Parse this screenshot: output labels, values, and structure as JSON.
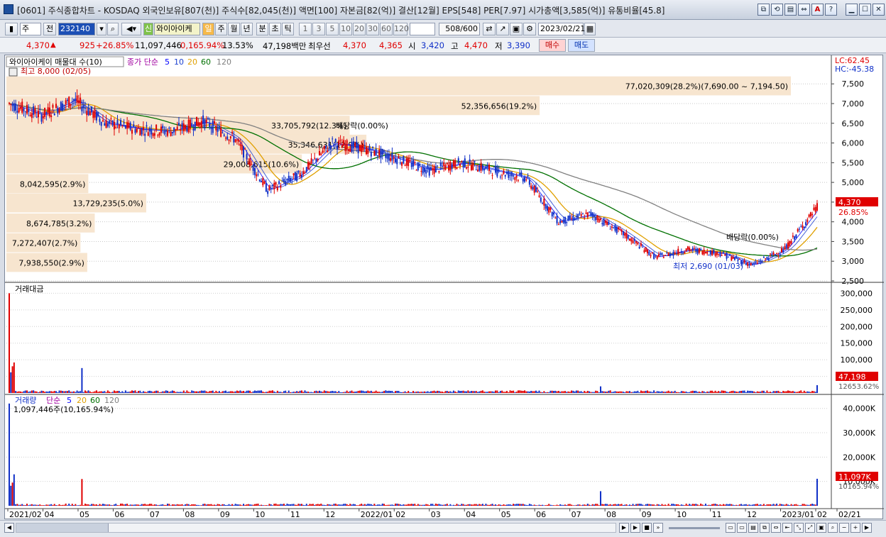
{
  "window": {
    "title": "[0601] 주식종합차트 - KOSDAQ 외국인보유[807(천)] 주식수[82,045(천)] 액면[100] 자본금[82(억)] 결산[12월] EPS[548] PER[7.97] 시가총액[3,585(억)] 유통비율[45.8]",
    "buttons": [
      "⧉",
      "⟲",
      "▤",
      "⇔",
      "A",
      "?",
      "▁",
      "☐",
      "✕"
    ]
  },
  "toolbar": {
    "type_label": "주",
    "prev_label": "전",
    "code": "232140",
    "stock_name": "와이아이케",
    "period_day": "일",
    "period_week": "주",
    "period_month": "월",
    "period_year": "년",
    "period_minute": "분",
    "period_second": "초",
    "period_tick": "틱",
    "intervals": [
      "1",
      "3",
      "5",
      "10",
      "20",
      "30",
      "60",
      "120"
    ],
    "count": "508",
    "count_max": "/600",
    "date": "2023/02/21"
  },
  "quote": {
    "price": "4,370",
    "change": "925",
    "change_pct": "+26.85%",
    "volume": "11,097,446",
    "volume_ratio": "0,165.94%",
    "turnover_pct": "13.53%",
    "amount": "47,198백만",
    "best_label": "최우선",
    "ask": "4,370",
    "bid": "4,365",
    "open_label": "시",
    "open": "3,420",
    "high_label": "고",
    "high": "4,470",
    "low_label": "저",
    "low": "3,390",
    "buy_label": "매수",
    "sell_label": "매도"
  },
  "price_panel": {
    "legend_name": "와이아이케이 매물대 수(10)",
    "legend_ma": "종가 단순",
    "ma_periods": [
      "5",
      "10",
      "20",
      "60",
      "120"
    ],
    "ma_colors": [
      "#0000ff",
      "#1a3fd0",
      "#e0a000",
      "#007000",
      "#808080"
    ],
    "lc": "LC:62.45",
    "hc": "HC:-45.38",
    "high_note": "최고 8,000 (02/05)",
    "low_note": "최저 2,690 (01/03)",
    "dividend_note": "배당락(0.00%)",
    "current_price": "4,370",
    "current_pct": "26.85%",
    "y_ticks": [
      "7,500",
      "7,000",
      "6,500",
      "6,000",
      "5,500",
      "5,000",
      "4,500",
      "4,000",
      "3,500",
      "3,000",
      "2,500"
    ],
    "volume_profile": [
      {
        "label": "77,020,309(28.2%)(7,690.00 ~ 7,194.50)",
        "value": 77020309,
        "price": 7440
      },
      {
        "label": "52,356,656(19.2%)",
        "value": 52356656,
        "price": 6940
      },
      {
        "label": "33,705,792(12.3%)",
        "value": 33705792,
        "price": 6440
      },
      {
        "label": "35,346,631(12.9%)",
        "value": 35346631,
        "price": 5960
      },
      {
        "label": "29,008,615(10.6%)",
        "value": 29008615,
        "price": 5460
      },
      {
        "label": "8,042,595(2.9%)",
        "value": 8042595,
        "price": 4960
      },
      {
        "label": "13,729,235(5.0%)",
        "value": 13729235,
        "price": 4470
      },
      {
        "label": "8,674,785(3.2%)",
        "value": 8674785,
        "price": 3960
      },
      {
        "label": "7,272,407(2.7%)",
        "value": 7272407,
        "price": 3460
      },
      {
        "label": "7,938,550(2.9%)",
        "value": 7938550,
        "price": 2960
      }
    ]
  },
  "amount_panel": {
    "legend": "거래대금",
    "y_ticks": [
      "300,000",
      "250,000",
      "200,000",
      "150,000",
      "100,000",
      "50,000"
    ],
    "current": "47,198",
    "current_pct": "12653.62%"
  },
  "volume_panel": {
    "legend": "거래량",
    "legend_ma": "단순",
    "ma_periods": [
      "5",
      "20",
      "60",
      "120"
    ],
    "note": "1,097,446주(10,165.94%)",
    "y_ticks": [
      "40,000K",
      "30,000K",
      "20,000K",
      "10,000K"
    ],
    "current": "11,097K",
    "current_pct": "10165.94%"
  },
  "x_axis": [
    "2021/02",
    "04",
    "05",
    "06",
    "07",
    "08",
    "09",
    "10",
    "11",
    "12",
    "2022/01",
    "02",
    "03",
    "04",
    "05",
    "06",
    "07",
    "08",
    "09",
    "10",
    "11",
    "12",
    "2023/01",
    "02",
    "02/21"
  ],
  "chart_data": {
    "type": "line",
    "title": "",
    "x": [
      "2021/02",
      "2021/03",
      "2021/04",
      "2021/05",
      "2021/06",
      "2021/07",
      "2021/08",
      "2021/09",
      "2021/10",
      "2021/11",
      "2021/12",
      "2022/01",
      "2022/02",
      "2022/03",
      "2022/04",
      "2022/05",
      "2022/06",
      "2022/07",
      "2022/08",
      "2022/09",
      "2022/10",
      "2022/11",
      "2022/12",
      "2023/01",
      "2023/02",
      "2023/02/21"
    ],
    "series": [
      {
        "name": "종가",
        "values": [
          7000,
          6700,
          7100,
          6500,
          6350,
          6300,
          6550,
          6100,
          4800,
          5200,
          6000,
          5850,
          5600,
          5300,
          5500,
          5300,
          5100,
          4000,
          4200,
          3700,
          3100,
          3300,
          3200,
          2900,
          3300,
          4370
        ]
      }
    ],
    "ylim": [
      2500,
      7900
    ],
    "y_scale": "linear",
    "grid": true
  }
}
